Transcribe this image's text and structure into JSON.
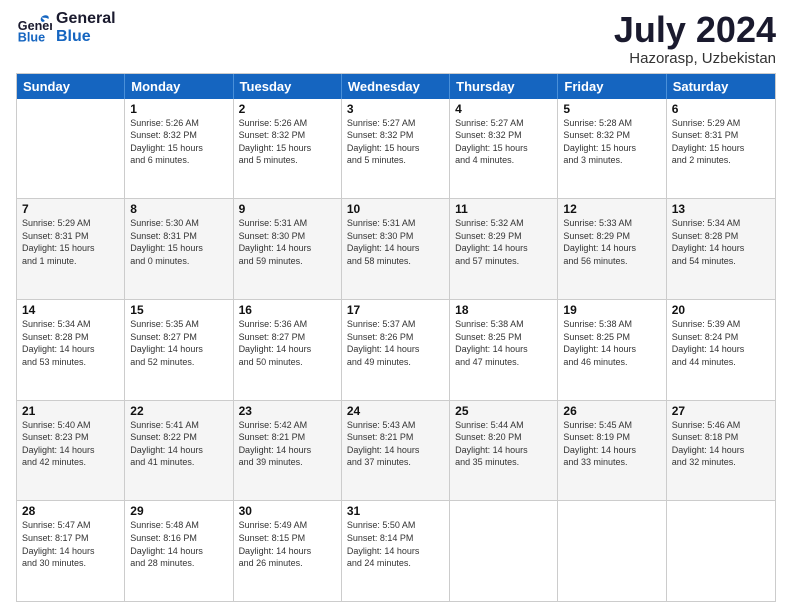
{
  "logo": {
    "line1": "General",
    "line2": "Blue"
  },
  "title": "July 2024",
  "location": "Hazorasp, Uzbekistan",
  "days_of_week": [
    "Sunday",
    "Monday",
    "Tuesday",
    "Wednesday",
    "Thursday",
    "Friday",
    "Saturday"
  ],
  "weeks": [
    [
      {
        "day": "",
        "lines": []
      },
      {
        "day": "1",
        "lines": [
          "Sunrise: 5:26 AM",
          "Sunset: 8:32 PM",
          "Daylight: 15 hours",
          "and 6 minutes."
        ]
      },
      {
        "day": "2",
        "lines": [
          "Sunrise: 5:26 AM",
          "Sunset: 8:32 PM",
          "Daylight: 15 hours",
          "and 5 minutes."
        ]
      },
      {
        "day": "3",
        "lines": [
          "Sunrise: 5:27 AM",
          "Sunset: 8:32 PM",
          "Daylight: 15 hours",
          "and 5 minutes."
        ]
      },
      {
        "day": "4",
        "lines": [
          "Sunrise: 5:27 AM",
          "Sunset: 8:32 PM",
          "Daylight: 15 hours",
          "and 4 minutes."
        ]
      },
      {
        "day": "5",
        "lines": [
          "Sunrise: 5:28 AM",
          "Sunset: 8:32 PM",
          "Daylight: 15 hours",
          "and 3 minutes."
        ]
      },
      {
        "day": "6",
        "lines": [
          "Sunrise: 5:29 AM",
          "Sunset: 8:31 PM",
          "Daylight: 15 hours",
          "and 2 minutes."
        ]
      }
    ],
    [
      {
        "day": "7",
        "lines": [
          "Sunrise: 5:29 AM",
          "Sunset: 8:31 PM",
          "Daylight: 15 hours",
          "and 1 minute."
        ]
      },
      {
        "day": "8",
        "lines": [
          "Sunrise: 5:30 AM",
          "Sunset: 8:31 PM",
          "Daylight: 15 hours",
          "and 0 minutes."
        ]
      },
      {
        "day": "9",
        "lines": [
          "Sunrise: 5:31 AM",
          "Sunset: 8:30 PM",
          "Daylight: 14 hours",
          "and 59 minutes."
        ]
      },
      {
        "day": "10",
        "lines": [
          "Sunrise: 5:31 AM",
          "Sunset: 8:30 PM",
          "Daylight: 14 hours",
          "and 58 minutes."
        ]
      },
      {
        "day": "11",
        "lines": [
          "Sunrise: 5:32 AM",
          "Sunset: 8:29 PM",
          "Daylight: 14 hours",
          "and 57 minutes."
        ]
      },
      {
        "day": "12",
        "lines": [
          "Sunrise: 5:33 AM",
          "Sunset: 8:29 PM",
          "Daylight: 14 hours",
          "and 56 minutes."
        ]
      },
      {
        "day": "13",
        "lines": [
          "Sunrise: 5:34 AM",
          "Sunset: 8:28 PM",
          "Daylight: 14 hours",
          "and 54 minutes."
        ]
      }
    ],
    [
      {
        "day": "14",
        "lines": [
          "Sunrise: 5:34 AM",
          "Sunset: 8:28 PM",
          "Daylight: 14 hours",
          "and 53 minutes."
        ]
      },
      {
        "day": "15",
        "lines": [
          "Sunrise: 5:35 AM",
          "Sunset: 8:27 PM",
          "Daylight: 14 hours",
          "and 52 minutes."
        ]
      },
      {
        "day": "16",
        "lines": [
          "Sunrise: 5:36 AM",
          "Sunset: 8:27 PM",
          "Daylight: 14 hours",
          "and 50 minutes."
        ]
      },
      {
        "day": "17",
        "lines": [
          "Sunrise: 5:37 AM",
          "Sunset: 8:26 PM",
          "Daylight: 14 hours",
          "and 49 minutes."
        ]
      },
      {
        "day": "18",
        "lines": [
          "Sunrise: 5:38 AM",
          "Sunset: 8:25 PM",
          "Daylight: 14 hours",
          "and 47 minutes."
        ]
      },
      {
        "day": "19",
        "lines": [
          "Sunrise: 5:38 AM",
          "Sunset: 8:25 PM",
          "Daylight: 14 hours",
          "and 46 minutes."
        ]
      },
      {
        "day": "20",
        "lines": [
          "Sunrise: 5:39 AM",
          "Sunset: 8:24 PM",
          "Daylight: 14 hours",
          "and 44 minutes."
        ]
      }
    ],
    [
      {
        "day": "21",
        "lines": [
          "Sunrise: 5:40 AM",
          "Sunset: 8:23 PM",
          "Daylight: 14 hours",
          "and 42 minutes."
        ]
      },
      {
        "day": "22",
        "lines": [
          "Sunrise: 5:41 AM",
          "Sunset: 8:22 PM",
          "Daylight: 14 hours",
          "and 41 minutes."
        ]
      },
      {
        "day": "23",
        "lines": [
          "Sunrise: 5:42 AM",
          "Sunset: 8:21 PM",
          "Daylight: 14 hours",
          "and 39 minutes."
        ]
      },
      {
        "day": "24",
        "lines": [
          "Sunrise: 5:43 AM",
          "Sunset: 8:21 PM",
          "Daylight: 14 hours",
          "and 37 minutes."
        ]
      },
      {
        "day": "25",
        "lines": [
          "Sunrise: 5:44 AM",
          "Sunset: 8:20 PM",
          "Daylight: 14 hours",
          "and 35 minutes."
        ]
      },
      {
        "day": "26",
        "lines": [
          "Sunrise: 5:45 AM",
          "Sunset: 8:19 PM",
          "Daylight: 14 hours",
          "and 33 minutes."
        ]
      },
      {
        "day": "27",
        "lines": [
          "Sunrise: 5:46 AM",
          "Sunset: 8:18 PM",
          "Daylight: 14 hours",
          "and 32 minutes."
        ]
      }
    ],
    [
      {
        "day": "28",
        "lines": [
          "Sunrise: 5:47 AM",
          "Sunset: 8:17 PM",
          "Daylight: 14 hours",
          "and 30 minutes."
        ]
      },
      {
        "day": "29",
        "lines": [
          "Sunrise: 5:48 AM",
          "Sunset: 8:16 PM",
          "Daylight: 14 hours",
          "and 28 minutes."
        ]
      },
      {
        "day": "30",
        "lines": [
          "Sunrise: 5:49 AM",
          "Sunset: 8:15 PM",
          "Daylight: 14 hours",
          "and 26 minutes."
        ]
      },
      {
        "day": "31",
        "lines": [
          "Sunrise: 5:50 AM",
          "Sunset: 8:14 PM",
          "Daylight: 14 hours",
          "and 24 minutes."
        ]
      },
      {
        "day": "",
        "lines": []
      },
      {
        "day": "",
        "lines": []
      },
      {
        "day": "",
        "lines": []
      }
    ]
  ]
}
